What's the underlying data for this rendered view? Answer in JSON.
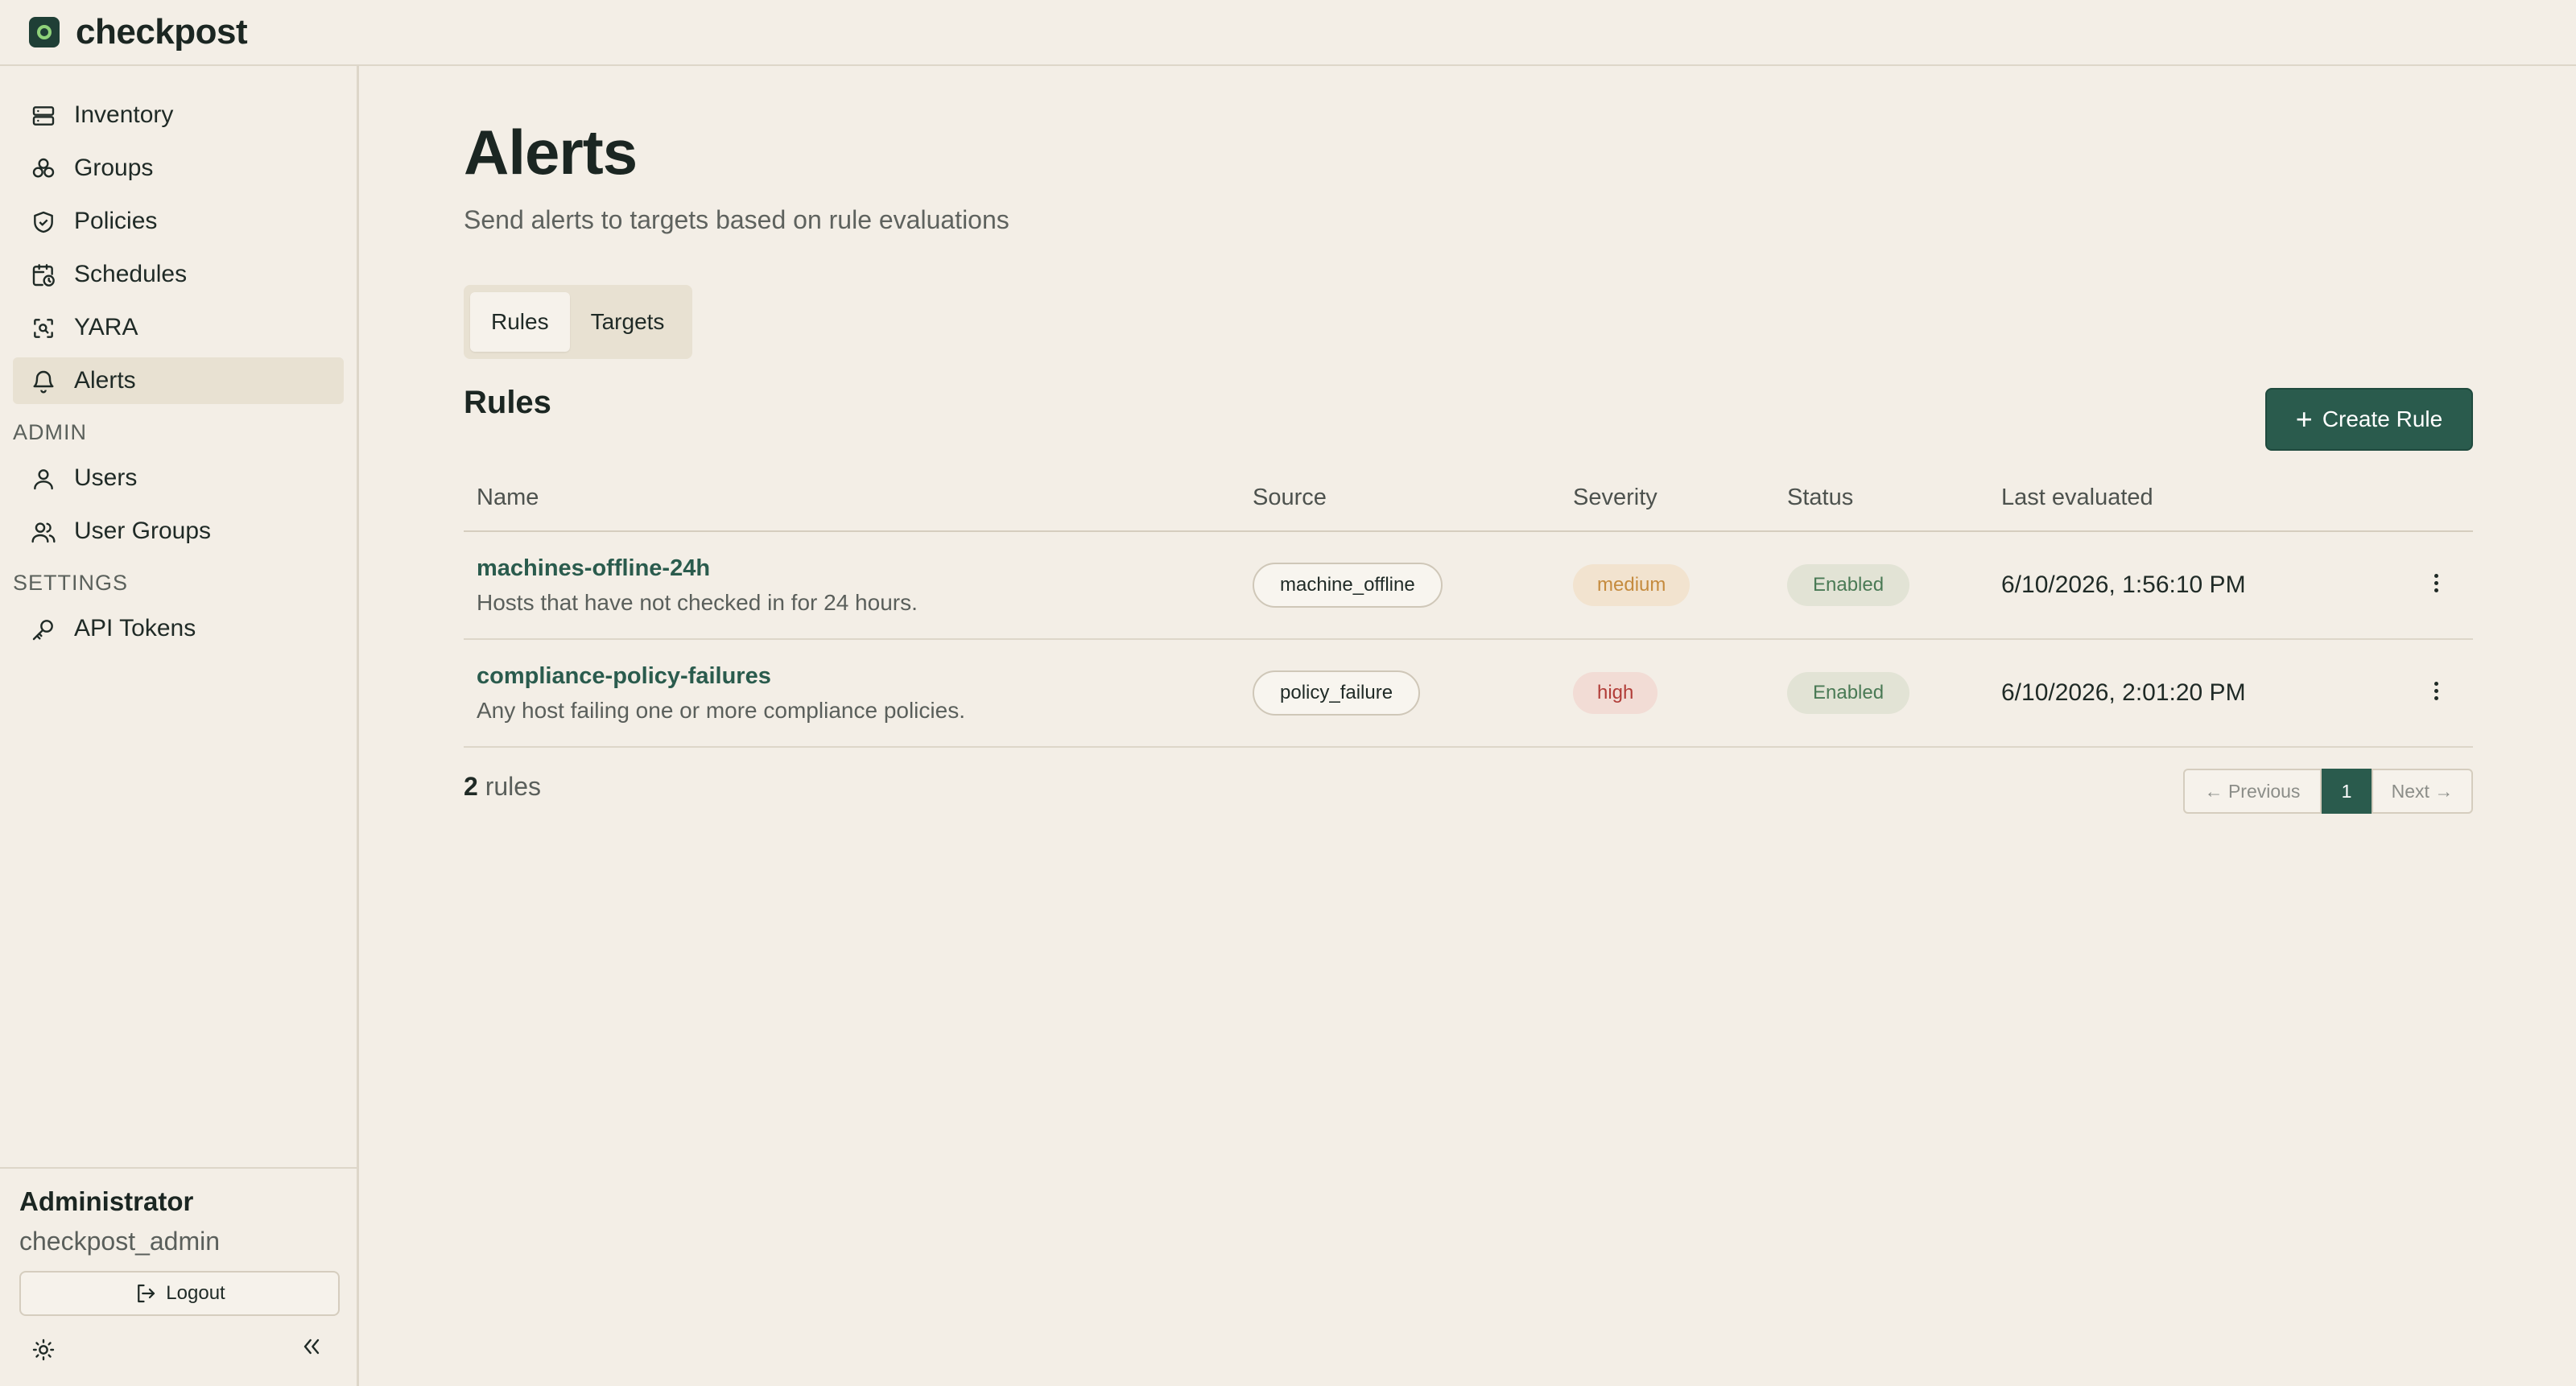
{
  "app": {
    "brand": "checkpost"
  },
  "sidebar": {
    "items": [
      {
        "label": "Inventory",
        "icon": "server-icon"
      },
      {
        "label": "Groups",
        "icon": "groups-icon"
      },
      {
        "label": "Policies",
        "icon": "shield-icon"
      },
      {
        "label": "Schedules",
        "icon": "calendar-clock-icon"
      },
      {
        "label": "YARA",
        "icon": "scan-icon"
      },
      {
        "label": "Alerts",
        "icon": "bell-icon",
        "active": true
      }
    ],
    "admin_label": "ADMIN",
    "admin_items": [
      {
        "label": "Users",
        "icon": "user-icon"
      },
      {
        "label": "User Groups",
        "icon": "users-icon"
      }
    ],
    "settings_label": "SETTINGS",
    "settings_items": [
      {
        "label": "API Tokens",
        "icon": "key-icon"
      }
    ],
    "footer": {
      "role": "Administrator",
      "username": "checkpost_admin",
      "logout_label": "Logout"
    }
  },
  "main": {
    "title": "Alerts",
    "subtitle": "Send alerts to targets based on rule evaluations",
    "tabs": [
      {
        "label": "Rules",
        "active": true
      },
      {
        "label": "Targets"
      }
    ],
    "section_title": "Rules",
    "create_label": "Create Rule",
    "table": {
      "headers": [
        "Name",
        "Source",
        "Severity",
        "Status",
        "Last evaluated"
      ],
      "rows": [
        {
          "name": "machines-offline-24h",
          "description": "Hosts that have not checked in for 24 hours.",
          "source": "machine_offline",
          "severity": "medium",
          "status": "Enabled",
          "last_evaluated": "6/10/2026, 1:56:10 PM"
        },
        {
          "name": "compliance-policy-failures",
          "description": "Any host failing one or more compliance policies.",
          "source": "policy_failure",
          "severity": "high",
          "status": "Enabled",
          "last_evaluated": "6/10/2026, 2:01:20 PM"
        }
      ]
    },
    "footer": {
      "count": "2",
      "count_label": "rules",
      "prev_label": "← Previous",
      "page": "1",
      "next_label": "Next →"
    }
  },
  "colors": {
    "background": "#f3eee6",
    "accent": "#2a5b4d",
    "severity_medium": "#c58b3e",
    "severity_high": "#b13d38",
    "status_enabled": "#4a7a55"
  }
}
